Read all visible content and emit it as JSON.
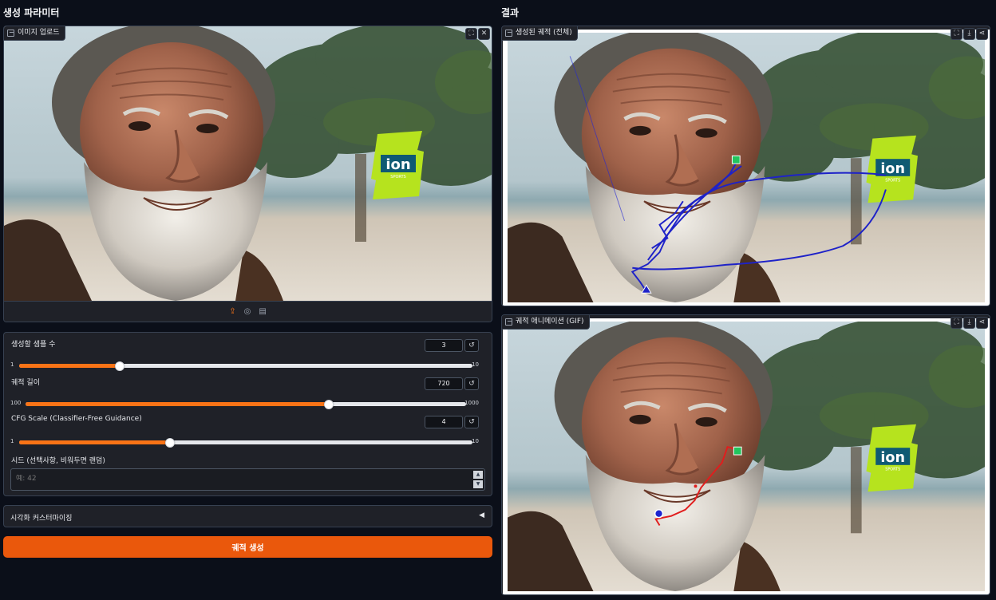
{
  "left_panel": {
    "title": "생성 파라미터",
    "upload": {
      "label": "이미지 업로드",
      "fullscreen_icon": "fullscreen-icon",
      "close_icon": "close-icon",
      "toolbar_icons": [
        "upload-icon",
        "webcam-icon",
        "clipboard-icon"
      ]
    },
    "params": [
      {
        "label": "생성할 샘플 수",
        "value": "3",
        "min": "1",
        "max": "10",
        "fraction": 0.222
      },
      {
        "label": "궤적 길이",
        "value": "720",
        "min": "100",
        "max": "1000",
        "fraction": 0.689
      },
      {
        "label": "CFG Scale (Classifier-Free Guidance)",
        "value": "4",
        "min": "1",
        "max": "10",
        "fraction": 0.333
      }
    ],
    "seed": {
      "label": "시드 (선택사항, 비워두면 랜덤)",
      "placeholder": "예: 42",
      "value": ""
    },
    "accordion": {
      "label": "시각화 커스터마이징",
      "arrow": "◀"
    },
    "generate_button": "궤적 생성"
  },
  "right_panel": {
    "title": "결과",
    "trajectory_full": {
      "label": "생성된 궤적 (전체)"
    },
    "trajectory_gif": {
      "label": "궤적 애니메이션 (GIF)"
    },
    "corner_icons": [
      "fullscreen-icon",
      "download-icon",
      "share-icon"
    ]
  },
  "colors": {
    "accent": "#f97316",
    "button": "#ea580c",
    "background": "#0b0f19",
    "panel": "#1f2128",
    "trajectory_blue": "#1e22c8",
    "trajectory_red": "#e11d1d",
    "start_marker": "#22c55e"
  }
}
